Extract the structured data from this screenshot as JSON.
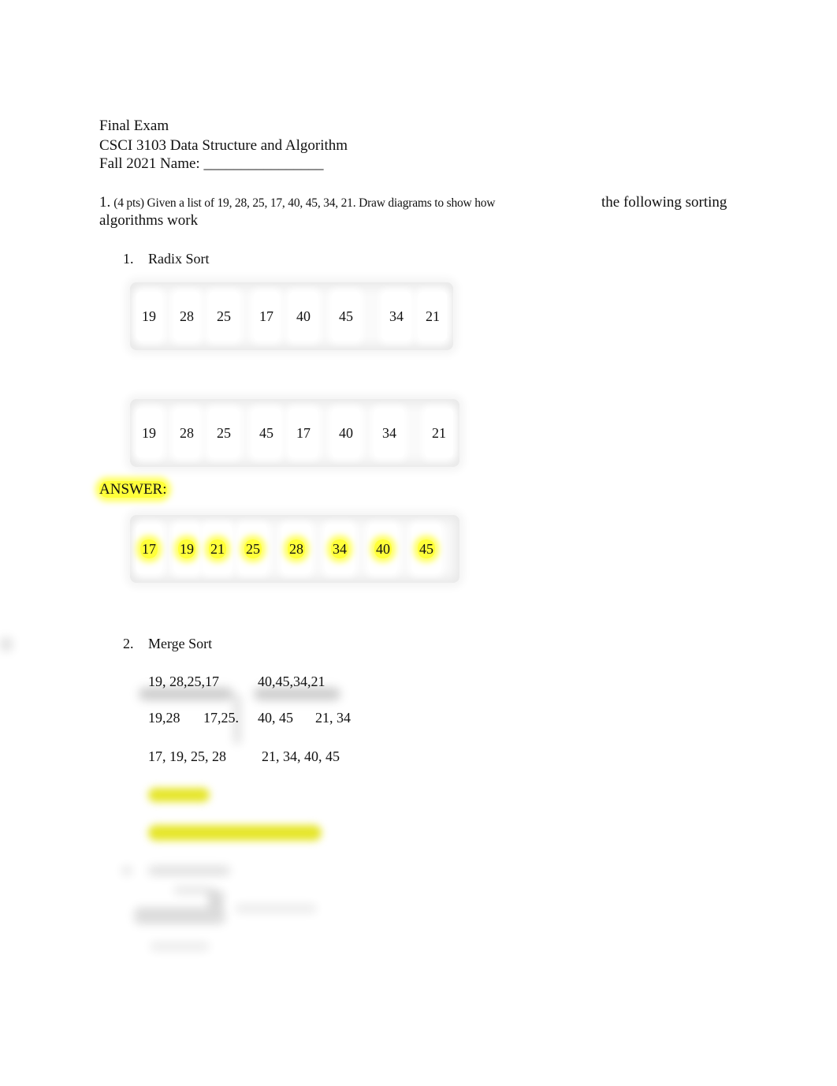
{
  "header": {
    "line1": "Final Exam",
    "line2": "CSCI 3103 Data Structure and Algorithm",
    "line3": "Fall 2021 Name: ________________"
  },
  "question1": {
    "number": "1.",
    "prompt_small": "(4 pts) Given a list of 19, 28, 25, 17, 40, 45, 34, 21. Draw diagrams to show how",
    "prompt_tail": "the following sorting",
    "prompt_line2": "algorithms work"
  },
  "radix_sort": {
    "number": "1.",
    "label": "Radix Sort",
    "row1": [
      "19",
      "28",
      "25",
      "17",
      "40",
      "45",
      "34",
      "21"
    ],
    "row2": [
      "19",
      "28",
      "25",
      "45",
      "17",
      "40",
      "34",
      "21"
    ],
    "answer_label": "ANSWER:",
    "answer_row": [
      "17",
      "19",
      "21",
      "25",
      "28",
      "34",
      "40",
      "45"
    ]
  },
  "merge_sort": {
    "number": "2.",
    "label": "Merge Sort",
    "lines": [
      [
        "19, 28,25,17",
        "40,45,34,21"
      ],
      [
        "19,28",
        "17,25.",
        "40, 45",
        "21, 34"
      ],
      [
        "17, 19, 25, 28",
        "21, 34, 40, 45"
      ]
    ]
  },
  "highlight_color": "#ffff3a"
}
